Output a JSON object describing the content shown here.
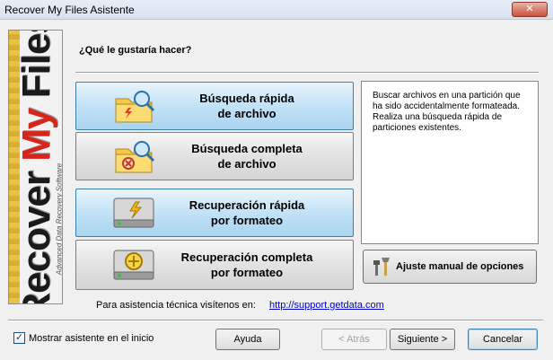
{
  "window": {
    "title": "Recover My Files Asistente",
    "close_glyph": "✕"
  },
  "logo": {
    "word1": "Recover",
    "word2": "My",
    "word3": "Files",
    "tagline": "Advanced Data Recovery Software"
  },
  "question": "¿Qué le gustaría hacer?",
  "options": [
    {
      "line1": "Búsqueda rápida",
      "line2": "de archivo",
      "icon": "folder-search-quick-icon",
      "selected": true
    },
    {
      "line1": "Búsqueda completa",
      "line2": "de archivo",
      "icon": "folder-search-complete-icon",
      "selected": false
    },
    {
      "line1": "Recuperación rápida",
      "line2": "por formateo",
      "icon": "drive-quick-icon",
      "selected": true
    },
    {
      "line1": "Recuperación completa",
      "line2": "por formateo",
      "icon": "drive-complete-icon",
      "selected": false
    }
  ],
  "description": "Buscar archivos en una partición que ha sido accidentalmente formateada. Realiza una búsqueda rápida de particiones existentes.",
  "manual_button": {
    "label": "Ajuste manual de opciones",
    "icon": "tools-icon"
  },
  "support": {
    "text": "Para asistencia técnica visítenos en:",
    "link": "http://support.getdata.com"
  },
  "startup_checkbox": {
    "label": "Mostrar asistente en el inicio",
    "checked": true
  },
  "buttons": {
    "help": "Ayuda",
    "back": "< Atrás",
    "next": "Siguiente >",
    "cancel": "Cancelar"
  },
  "colors": {
    "selected_option": "#c2e2f6",
    "logo_red": "#d6261c",
    "link": "#0000cc"
  }
}
